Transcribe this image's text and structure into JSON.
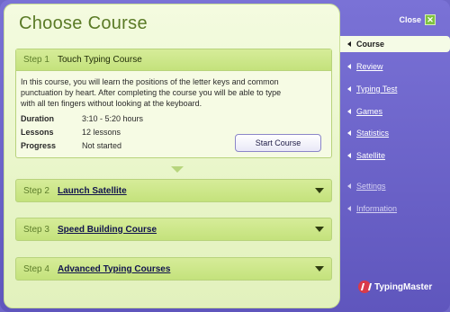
{
  "header": {
    "title": "Choose Course"
  },
  "steps": [
    {
      "number": "Step 1",
      "name": "Touch Typing Course",
      "description": "In this course, you will learn the positions of the letter keys and common punctuation by heart. After completing the course you will be able to type with all ten fingers without looking at the keyboard.",
      "details": [
        {
          "label": "Duration",
          "value": "3:10 - 5:20 hours"
        },
        {
          "label": "Lessons",
          "value": "12 lessons"
        },
        {
          "label": "Progress",
          "value": "Not started"
        }
      ],
      "action": "Start Course"
    },
    {
      "number": "Step 2",
      "name": "Launch Satellite"
    },
    {
      "number": "Step 3",
      "name": "Speed Building Course"
    },
    {
      "number": "Step 4",
      "name": "Advanced Typing Courses"
    }
  ],
  "sidebar": {
    "close_label": "Close",
    "items": [
      {
        "label": "Course",
        "active": true
      },
      {
        "label": "Review"
      },
      {
        "label": "Typing Test"
      },
      {
        "label": "Games"
      },
      {
        "label": "Statistics"
      },
      {
        "label": "Satellite"
      },
      {
        "label": "Settings"
      },
      {
        "label": "Information"
      }
    ],
    "logo_text": "TypingMaster"
  },
  "colors": {
    "accent_purple": "#6f67c9",
    "panel_green": "#e8f5c8",
    "step_green": "#c4e27c",
    "title_green": "#5a7a26",
    "close_green": "#7fc241",
    "logo_red": "#d93a4a"
  },
  "icons": [
    "chevron-down-icon",
    "triangle-left-icon",
    "close-icon",
    "typingmaster-logo-icon",
    "arrow-down-icon"
  ]
}
